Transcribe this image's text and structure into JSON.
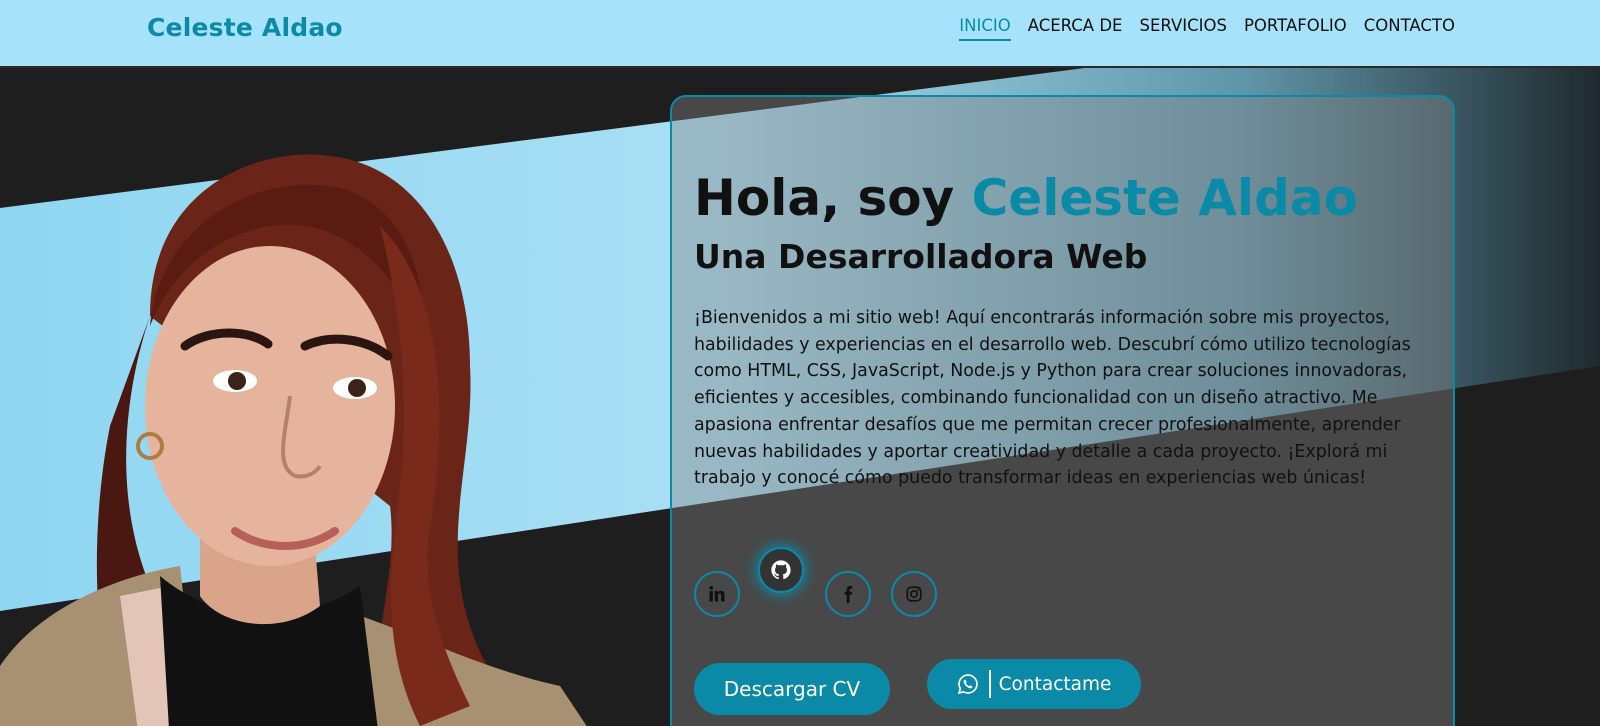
{
  "header": {
    "brand": "Celeste Aldao",
    "nav": [
      {
        "label": "INICIO",
        "active": true
      },
      {
        "label": "ACERCA DE",
        "active": false
      },
      {
        "label": "SERVICIOS",
        "active": false
      },
      {
        "label": "PORTAFOLIO",
        "active": false
      },
      {
        "label": "CONTACTO",
        "active": false
      }
    ]
  },
  "hero": {
    "greeting": "Hola, soy ",
    "name": "Celeste Aldao",
    "subtitle": "Una Desarrolladora Web",
    "intro": "¡Bienvenidos a mi sitio web! Aquí encontrarás información sobre mis proyectos, habilidades y experiencias en el desarrollo web. Descubrí cómo utilizo tecnologías como HTML, CSS, JavaScript, Node.js y Python para crear soluciones innovadoras, eficientes y accesibles, combinando funcionalidad con un diseño atractivo. Me apasiona enfrentar desafíos que me permitan crecer profesionalmente, aprender nuevas habilidades y aportar creatividad y detalle a cada proyecto. ¡Explorá mi trabajo y conocé cómo puedo transformar ideas en experiencias web únicas!",
    "socials": [
      {
        "icon": "linkedin-icon",
        "active": false
      },
      {
        "icon": "github-icon",
        "active": true
      },
      {
        "icon": "facebook-icon",
        "active": false
      },
      {
        "icon": "instagram-icon",
        "active": false
      }
    ],
    "buttons": {
      "cv": "Descargar CV",
      "contact": "Contactame"
    }
  },
  "colors": {
    "accent": "#0b8aa8",
    "header_bg": "#a6e3fa",
    "dark_bg": "#1e1e1e"
  }
}
